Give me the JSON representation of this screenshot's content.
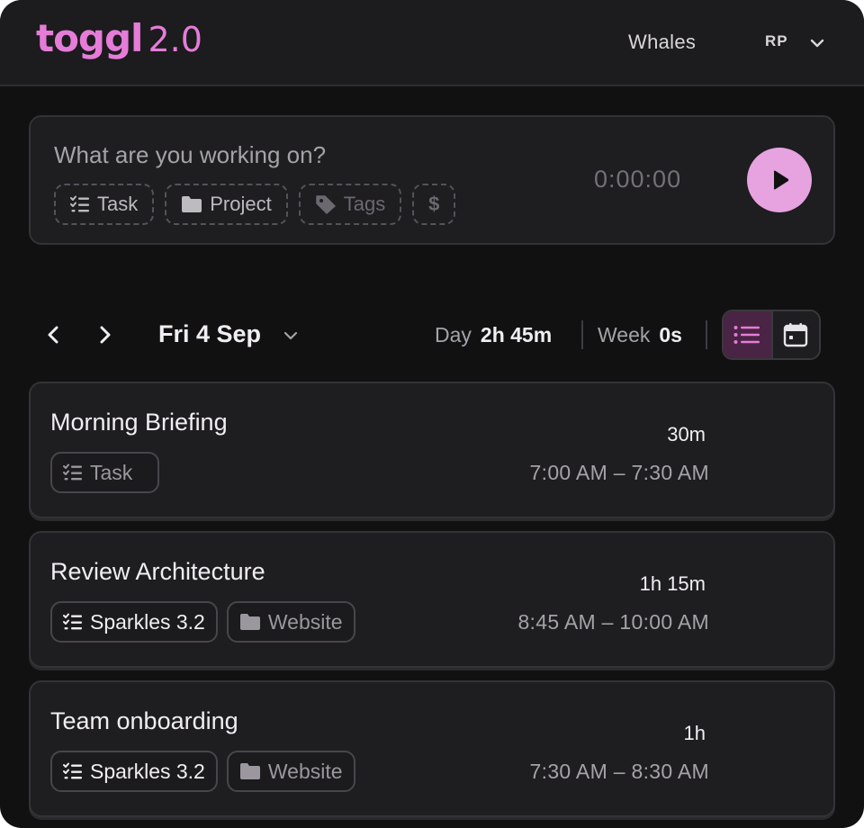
{
  "header": {
    "logo_word": "toggl",
    "logo_version": "2.0",
    "workspace": "Whales",
    "user_initials": "RP"
  },
  "timer": {
    "placeholder": "What are you working on?",
    "chips": {
      "task": "Task",
      "project": "Project",
      "tags": "Tags",
      "billable": "$"
    },
    "elapsed": "0:00:00"
  },
  "datebar": {
    "date": "Fri 4 Sep",
    "day_label": "Day",
    "day_total": "2h 45m",
    "week_label": "Week",
    "week_total": "0s"
  },
  "entries": [
    {
      "title": "Morning Briefing",
      "task": "Task",
      "project": "",
      "duration": "30m",
      "range": "7:00 AM – 7:30 AM"
    },
    {
      "title": "Review Architecture",
      "task": "Sparkles 3.2",
      "project": "Website",
      "duration": "1h 15m",
      "range": "8:45 AM – 10:00 AM"
    },
    {
      "title": "Team onboarding",
      "task": "Sparkles 3.2",
      "project": "Website",
      "duration": "1h",
      "range": "7:30 AM – 8:30 AM"
    }
  ],
  "colors": {
    "accent": "#e57cd8",
    "play": "#e7a2e0",
    "background": "#121112",
    "card": "#1e1d20"
  }
}
